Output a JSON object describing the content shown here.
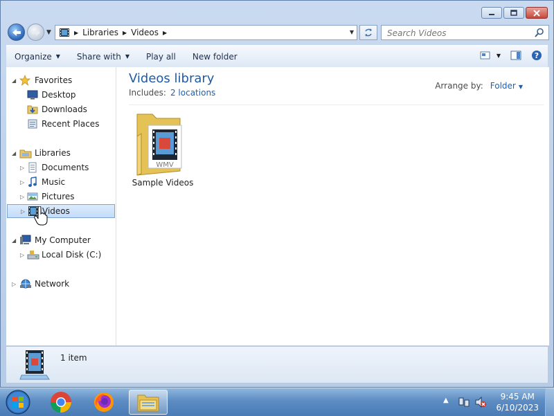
{
  "window": {
    "controls": {
      "minimize": "minimize-icon",
      "maximize": "maximize-icon",
      "close": "close-icon"
    }
  },
  "address": {
    "crumbs": [
      "Libraries",
      "Videos"
    ],
    "search_placeholder": "Search Videos"
  },
  "toolbar": {
    "organize": "Organize",
    "share_with": "Share with",
    "play_all": "Play all",
    "new_folder": "New folder"
  },
  "nav": {
    "favorites": {
      "label": "Favorites",
      "items": [
        "Desktop",
        "Downloads",
        "Recent Places"
      ]
    },
    "libraries": {
      "label": "Libraries",
      "items": [
        "Documents",
        "Music",
        "Pictures",
        "Videos"
      ]
    },
    "computer": {
      "label": "My Computer",
      "items": [
        "Local Disk (C:)"
      ]
    },
    "network": {
      "label": "Network"
    }
  },
  "content": {
    "title": "Videos library",
    "includes_label": "Includes:",
    "includes_link": "2 locations",
    "arrange_label": "Arrange by:",
    "arrange_value": "Folder",
    "items": [
      {
        "name": "Sample Videos",
        "badge": "WMV"
      }
    ]
  },
  "details": {
    "count": "1 item"
  },
  "taskbar": {
    "apps": [
      "start-orb-icon",
      "chrome-icon",
      "firefox-icon",
      "explorer-icon"
    ],
    "time": "9:45 AM",
    "date": "6/10/2023"
  },
  "colors": {
    "accent": "#1e5aa6",
    "link": "#1a5fb4",
    "selection": "#c2dcfa"
  }
}
